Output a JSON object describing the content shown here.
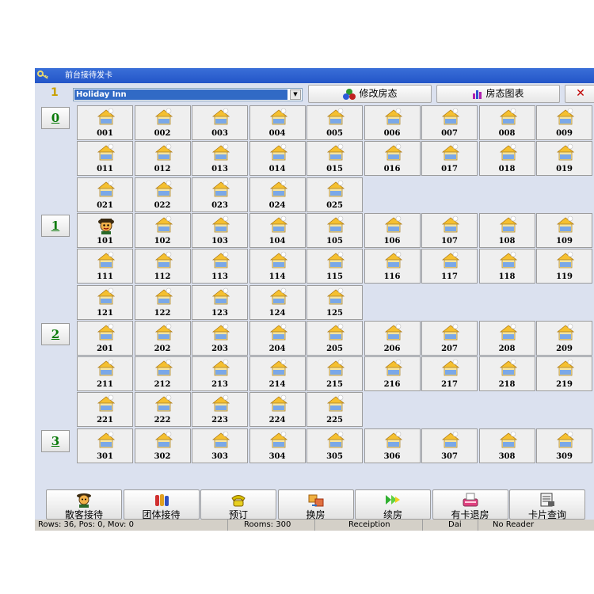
{
  "window": {
    "title": "前台接待发卡"
  },
  "toolbar": {
    "floor_indicator": "1",
    "hotel_select": "Holiday Inn",
    "modify_status_label": "修改房态",
    "status_chart_label": "房态图表",
    "close_label": "✕"
  },
  "floors": [
    "0",
    "1",
    "2",
    "3"
  ],
  "rooms": [
    [
      "001",
      "002",
      "003",
      "004",
      "005",
      "006",
      "007",
      "008",
      "009"
    ],
    [
      "011",
      "012",
      "013",
      "014",
      "015",
      "016",
      "017",
      "018",
      "019"
    ],
    [
      "021",
      "022",
      "023",
      "024",
      "025"
    ],
    [
      "101",
      "102",
      "103",
      "104",
      "105",
      "106",
      "107",
      "108",
      "109"
    ],
    [
      "111",
      "112",
      "113",
      "114",
      "115",
      "116",
      "117",
      "118",
      "119"
    ],
    [
      "121",
      "122",
      "123",
      "124",
      "125"
    ],
    [
      "201",
      "202",
      "203",
      "204",
      "205",
      "206",
      "207",
      "208",
      "209"
    ],
    [
      "211",
      "212",
      "213",
      "214",
      "215",
      "216",
      "217",
      "218",
      "219"
    ],
    [
      "221",
      "222",
      "223",
      "224",
      "225"
    ],
    [
      "301",
      "302",
      "303",
      "304",
      "305",
      "306",
      "307",
      "308",
      "309"
    ]
  ],
  "occupied_rooms": [
    "101"
  ],
  "actions": [
    {
      "label": "散客接待",
      "icon": "guest-face-icon"
    },
    {
      "label": "团体接待",
      "icon": "group-icon"
    },
    {
      "label": "预订",
      "icon": "telephone-icon"
    },
    {
      "label": "换房",
      "icon": "swap-room-icon"
    },
    {
      "label": "续房",
      "icon": "extend-arrows-icon"
    },
    {
      "label": "有卡退房",
      "icon": "card-checkout-icon"
    },
    {
      "label": "卡片查询",
      "icon": "card-query-icon"
    }
  ],
  "status": {
    "rows": "Rows: 36, Pos: 0, Mov: 0",
    "rooms": "Rooms:  300",
    "mode": "Receiption",
    "user": "Dai",
    "reader": "No Reader"
  },
  "colors": {
    "title_bar": "#2355c8",
    "floor_label": "#0a7a0a",
    "background": "#dbe1ef",
    "room_tile": "#efefef"
  }
}
